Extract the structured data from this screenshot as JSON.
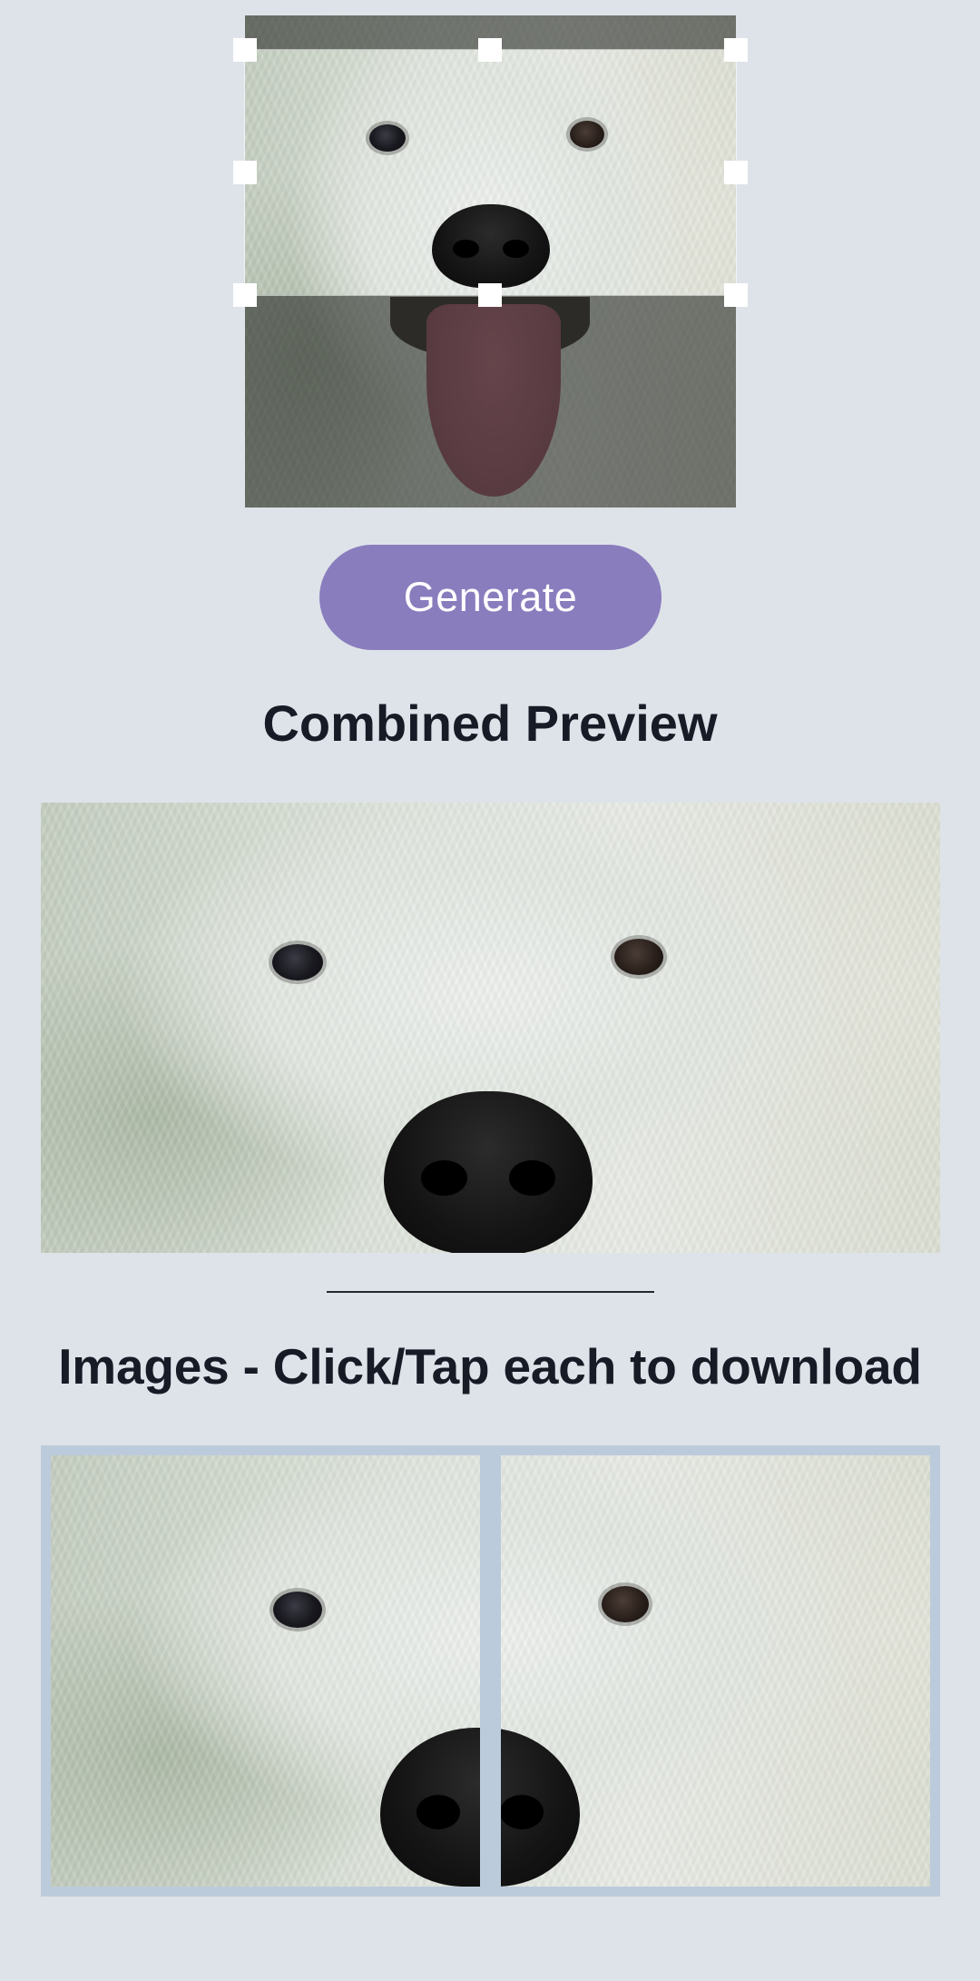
{
  "generate_button": {
    "label": "Generate"
  },
  "combined_preview": {
    "title": "Combined Preview"
  },
  "images_section": {
    "title": "Images - Click/Tap each to download"
  },
  "colors": {
    "background": "#dee3e9",
    "button": "#8a7dbe",
    "button_text": "#ffffff",
    "heading_text": "#161b26",
    "tile_frame": "#bccbdb"
  },
  "tiles": [
    {
      "name": "image-tile-1"
    },
    {
      "name": "image-tile-2"
    }
  ]
}
